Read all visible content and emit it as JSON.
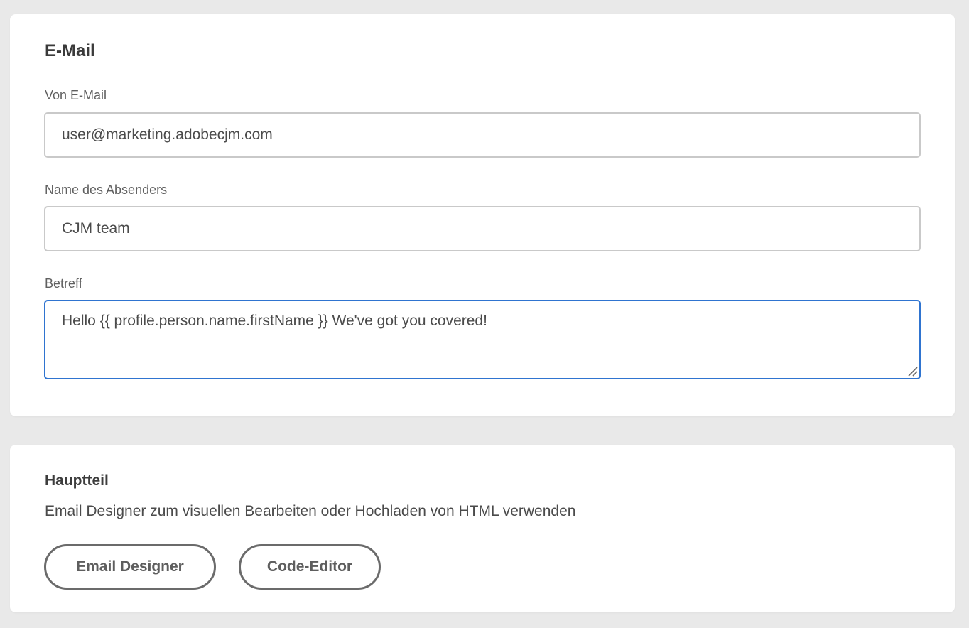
{
  "email_section": {
    "title": "E-Mail",
    "from_email": {
      "label": "Von E-Mail",
      "value": "user@marketing.adobecjm.com"
    },
    "sender_name": {
      "label": "Name des Absenders",
      "value": "CJM team"
    },
    "subject": {
      "label": "Betreff",
      "value": "Hello {{ profile.person.name.firstName }} We've got you covered!"
    }
  },
  "body_section": {
    "title": "Hauptteil",
    "description": "Email Designer zum visuellen Bearbeiten oder Hochladen von HTML verwenden",
    "buttons": {
      "email_designer": "Email Designer",
      "code_editor": "Code-Editor"
    }
  },
  "colors": {
    "focus_border": "#2f74d0",
    "page_background": "#e9e9e9",
    "card_background": "#ffffff"
  }
}
